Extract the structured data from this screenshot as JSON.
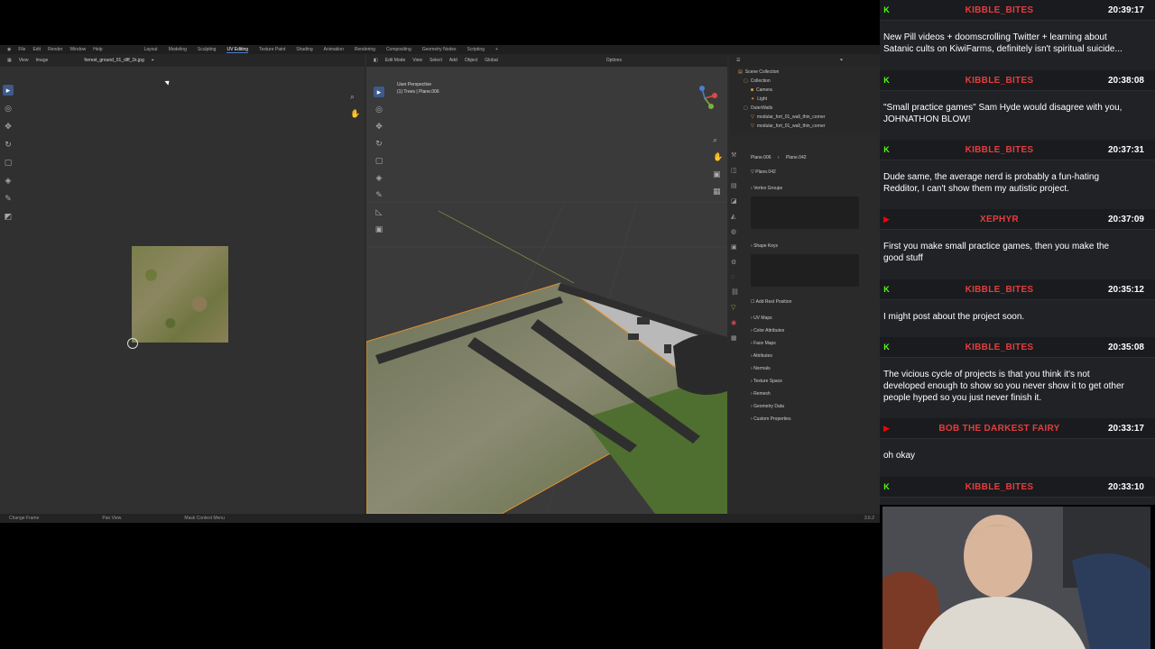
{
  "blender": {
    "menu": [
      "File",
      "Edit",
      "Render",
      "Window",
      "Help"
    ],
    "workspaces": [
      "Layout",
      "Modeling",
      "Sculpting",
      "UV Editing",
      "Texture Paint",
      "Shading",
      "Animation",
      "Rendering",
      "Compositing",
      "Geometry Nodes",
      "Scripting"
    ],
    "active_workspace": "UV Editing",
    "uv_editor": {
      "menu": [
        "View",
        "Image"
      ],
      "image_name": "forrest_ground_01_diff_1k.jpg"
    },
    "viewport": {
      "mode": "Edit Mode",
      "menu": [
        "View",
        "Select",
        "Add",
        "Object"
      ],
      "orientation": "Global",
      "options_label": "Options",
      "info_line1": "User Perspective",
      "info_line2": "(1) Trees | Plane.006"
    },
    "outliner": {
      "items": [
        {
          "label": "Scene Collection"
        },
        {
          "label": "Collection"
        },
        {
          "label": "Camera"
        },
        {
          "label": "Light"
        },
        {
          "label": "OuterWalls"
        },
        {
          "label": "modular_fort_01_wall_thin_corner"
        },
        {
          "label": "modular_fort_01_wall_thin_corner"
        }
      ]
    },
    "properties": {
      "object_name": "Plane.006",
      "mesh_name": "Plane.042",
      "data_name": "Plane.042",
      "panels": [
        "Vertex Groups",
        "Shape Keys",
        "Add Rest Position",
        "UV Maps",
        "Color Attributes",
        "Face Maps",
        "Attributes",
        "Normals",
        "Texture Space",
        "Remesh",
        "Geometry Data",
        "Custom Properties"
      ]
    },
    "status": {
      "items": [
        "Change Frame",
        "Pan View",
        "Mask Context Menu"
      ],
      "version": "3.6.2"
    }
  },
  "chat": {
    "messages": [
      {
        "user": "KIBBLE_BITES",
        "user_color": "#e53d3d",
        "badge": "K",
        "badge_color": "#53fc18",
        "time": "20:39:17",
        "lines": [
          "New Pill videos + doomscrolling Twitter + learning about",
          "Satanic cults on KiwiFarms, definitely isn't spiritual suicide..."
        ]
      },
      {
        "user": "KIBBLE_BITES",
        "user_color": "#e53d3d",
        "badge": "K",
        "badge_color": "#53fc18",
        "time": "20:38:08",
        "lines": [
          "\"Small practice games\" Sam Hyde would disagree with you,",
          "JOHNATHON BLOW!"
        ]
      },
      {
        "user": "KIBBLE_BITES",
        "user_color": "#e53d3d",
        "badge": "K",
        "badge_color": "#53fc18",
        "time": "20:37:31",
        "lines": [
          "Dude same, the average nerd is probably a fun-hating",
          "Redditor, I can't show them my autistic project."
        ]
      },
      {
        "user": "XEPHYR",
        "user_color": "#e53d3d",
        "badge": "▶",
        "badge_color": "#ff0000",
        "time": "20:37:09",
        "lines": [
          "First you make small practice games, then you make the",
          "good stuff"
        ]
      },
      {
        "user": "KIBBLE_BITES",
        "user_color": "#e53d3d",
        "badge": "K",
        "badge_color": "#53fc18",
        "time": "20:35:12",
        "lines": [
          "I might post about the project soon."
        ]
      },
      {
        "user": "KIBBLE_BITES",
        "user_color": "#e53d3d",
        "badge": "K",
        "badge_color": "#53fc18",
        "time": "20:35:08",
        "lines": [
          "The vicious cycle of projects is that you think it's not",
          "developed enough to show so you never show it to get other",
          "people hyped so you just never finish it."
        ]
      },
      {
        "user": "BOB THE DARKEST FAIRY",
        "user_color": "#e53d3d",
        "badge": "▶",
        "badge_color": "#ff0000",
        "time": "20:33:17",
        "lines": [
          "oh okay"
        ]
      },
      {
        "user": "KIBBLE_BITES",
        "user_color": "#e53d3d",
        "badge": "K",
        "badge_color": "#53fc18",
        "time": "20:33:10",
        "lines": []
      }
    ]
  }
}
